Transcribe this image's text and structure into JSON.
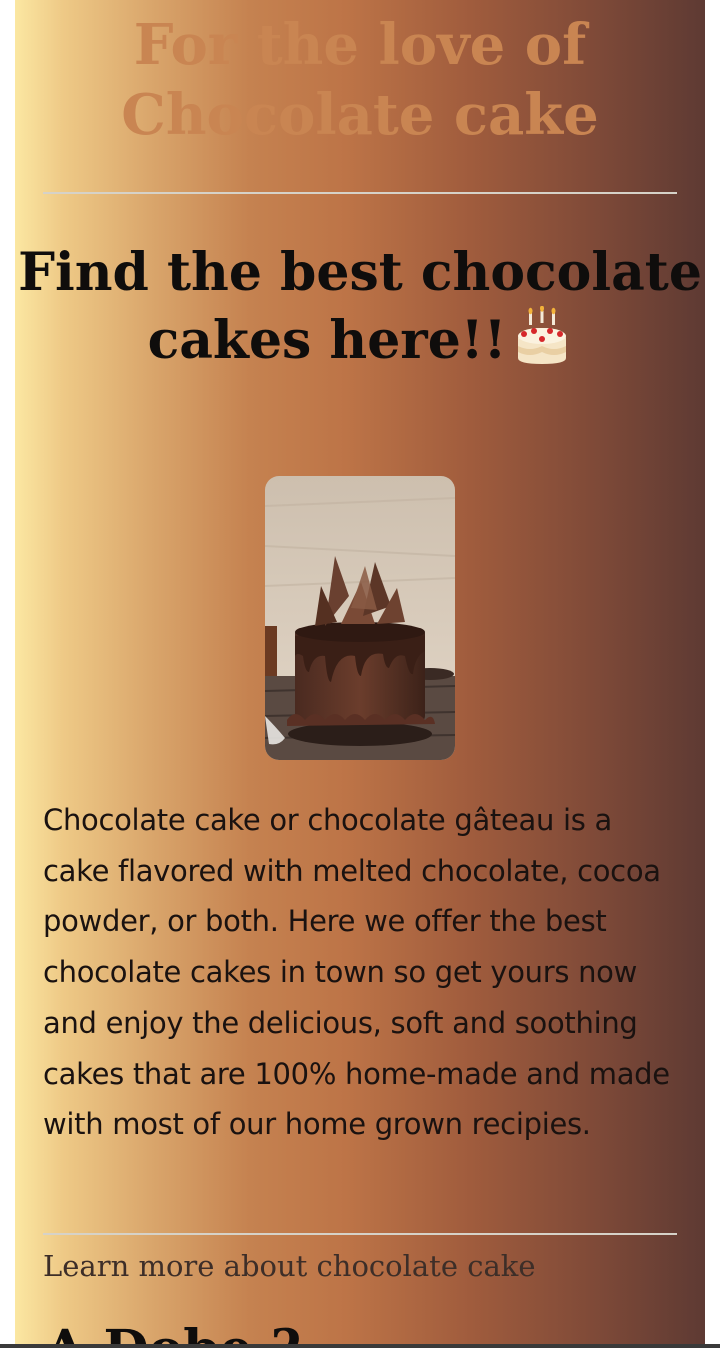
{
  "page": {
    "main_title": "For the love of Chocolate cake",
    "headline": "Find the best chocolate cakes here!!",
    "cake_emoji_icon": "birthday-cake-icon",
    "cake_image_alt": "chocolate cake",
    "description": "Chocolate cake or chocolate gâteau is a cake flavored with melted chocolate, cocoa powder, or both. Here we offer the best chocolate cakes in town so get yours now and enjoy the delicious, soft and soothing cakes that are 100% home-made and made with most of our home grown recipies.",
    "learn_more_link": "Learn more about chocolate cake",
    "next_section_heading_partial": "A             Dobe  ?"
  },
  "colors": {
    "title": "#c98552",
    "headline": "#0f0d0c",
    "gradient_left": "#fbe7a2",
    "gradient_mid": "#bd7447",
    "gradient_right": "#5e3a33"
  }
}
